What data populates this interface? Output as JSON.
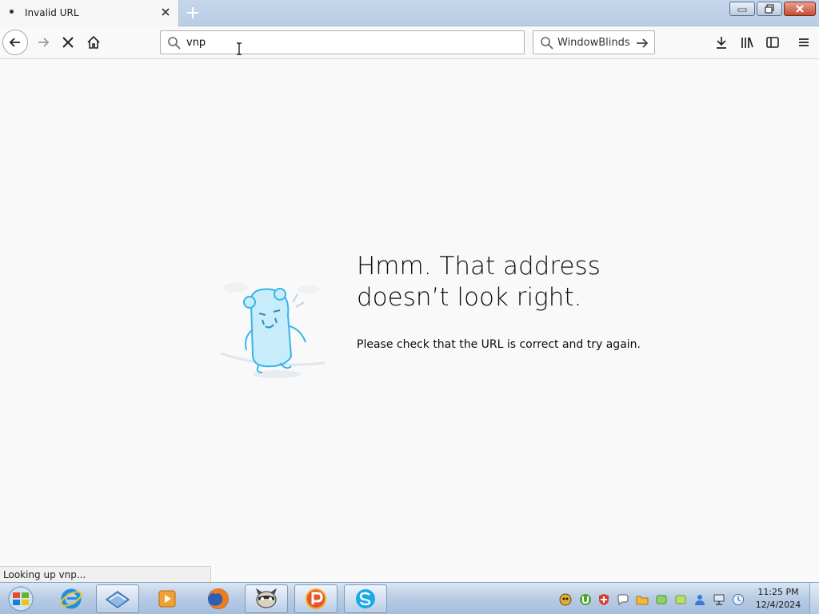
{
  "tab": {
    "title": "Invalid URL",
    "close_icon": "close-icon"
  },
  "newtab": {
    "icon": "plus-icon"
  },
  "window_controls": {
    "minimize": "minimize-icon",
    "restore": "restore-icon",
    "close": "close-icon"
  },
  "nav": {
    "back_icon": "back-arrow-icon",
    "forward_icon": "forward-arrow-icon",
    "stop_icon": "stop-icon",
    "home_icon": "home-icon"
  },
  "urlbar": {
    "value": "vnp",
    "icon": "search-icon"
  },
  "searchbar": {
    "engine": "WindowBlinds",
    "icon": "search-icon",
    "go_icon": "arrow-right-icon"
  },
  "toolbar": {
    "downloads_icon": "download-icon",
    "library_icon": "library-icon",
    "sidebar_icon": "sidebar-icon",
    "menu_icon": "hamburger-menu-icon"
  },
  "error": {
    "title": "Hmm. That address doesn’t look right.",
    "description": "Please check that the URL is correct and try again."
  },
  "status": {
    "text": "Looking up vnp..."
  },
  "taskbar": {
    "start_icon": "windows-start-icon",
    "items": [
      "internet-explorer-icon",
      "windowblinds-icon",
      "media-player-icon",
      "firefox-icon",
      "raccoon-app-icon",
      "app-p-icon",
      "skype-icon"
    ],
    "tray_icons": [
      "tray-app-icon",
      "utorrent-icon",
      "shield-icon",
      "chat-icon",
      "folder-icon",
      "green-leaf-icon",
      "green-leaf-icon",
      "network-user-icon",
      "network-icon",
      "clock-app-icon"
    ],
    "time": "11:25 PM",
    "date": "12/4/2024"
  }
}
